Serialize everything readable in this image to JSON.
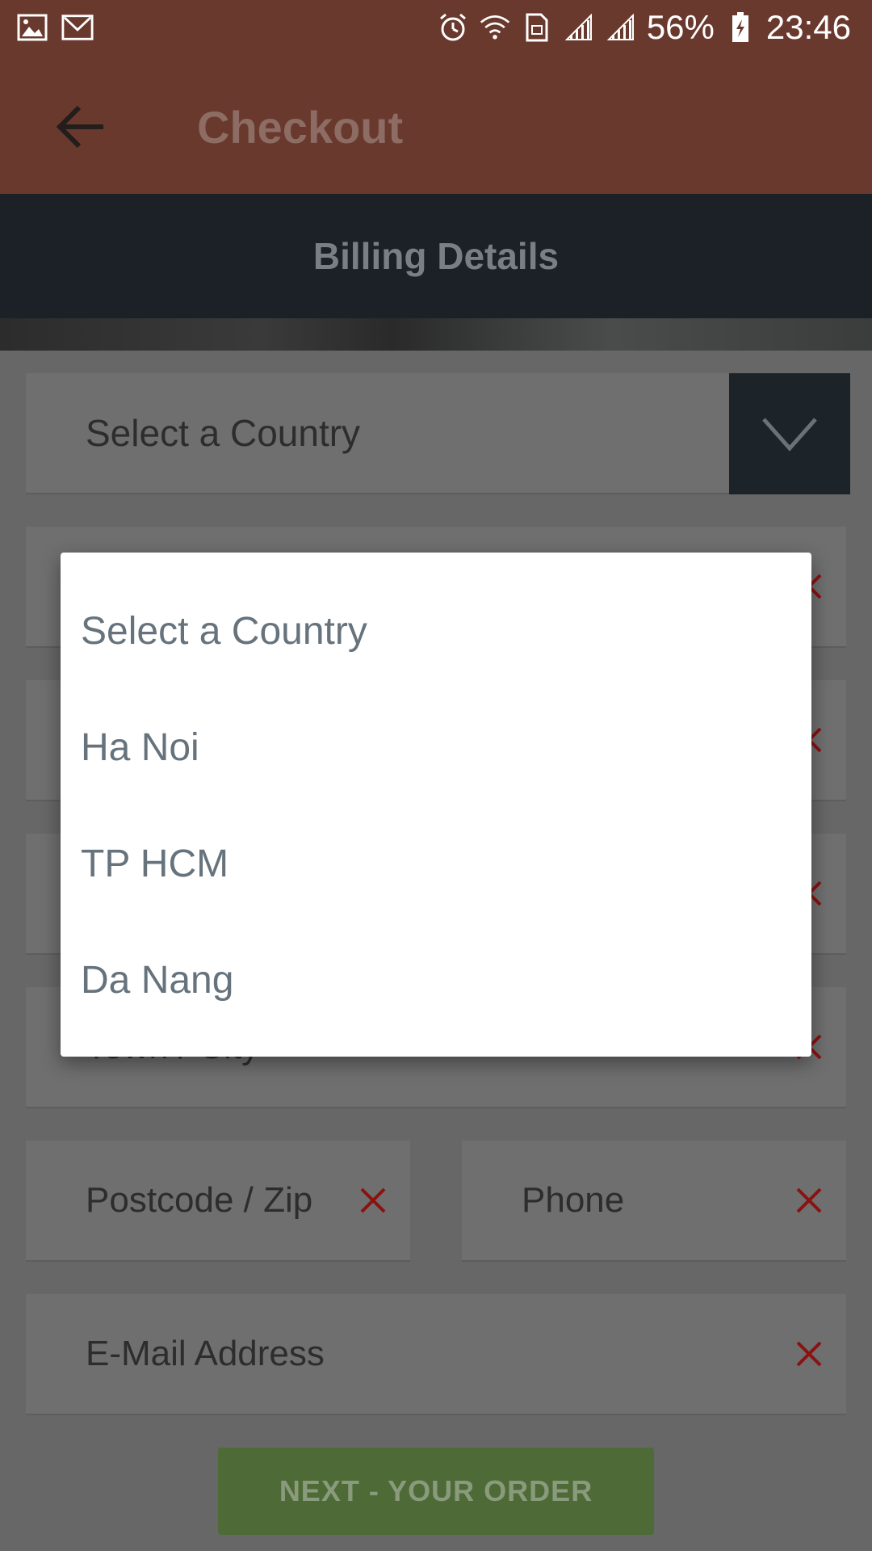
{
  "status_bar": {
    "battery": "56%",
    "time": "23:46"
  },
  "app_bar": {
    "title": "Checkout"
  },
  "section": {
    "title": "Billing Details"
  },
  "form": {
    "country_select": "Select a Country",
    "hidden_field_partial": "Town / City",
    "postcode": "Postcode / Zip",
    "phone": "Phone",
    "email": "E-Mail Address",
    "next_button": "NEXT - YOUR ORDER"
  },
  "dialog": {
    "options": [
      "Select a Country",
      "Ha Noi",
      "TP HCM",
      "Da Nang"
    ]
  },
  "colors": {
    "app_bar": "#6a392e",
    "section_bar": "#1b2126",
    "clear_icon": "#c01818",
    "next_button": "#4e6b37"
  }
}
